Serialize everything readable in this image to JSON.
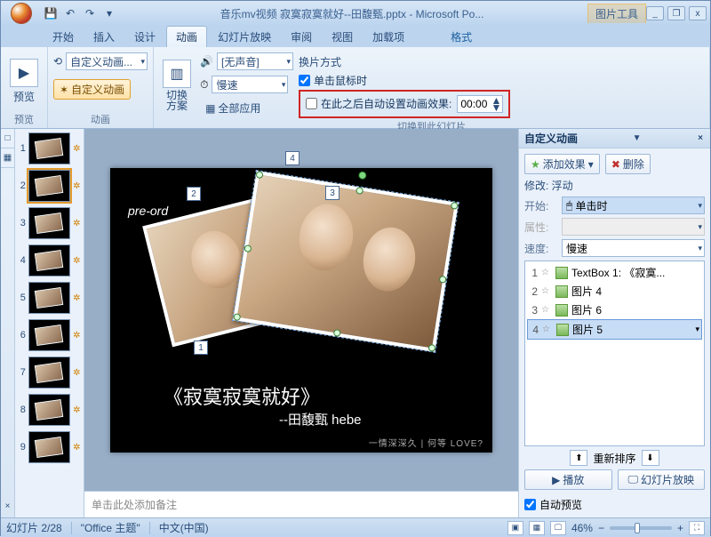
{
  "title": "音乐mv视频 寂寞寂寞就好--田馥甄.pptx - Microsoft Po...",
  "contextual_tab_group": "图片工具",
  "window_buttons": {
    "min": "_",
    "restore": "❐",
    "close": "x"
  },
  "tabs": {
    "items": [
      "开始",
      "插入",
      "设计",
      "动画",
      "幻灯片放映",
      "审阅",
      "视图",
      "加载项"
    ],
    "context": "格式",
    "active_index": 3
  },
  "ribbon": {
    "preview": {
      "label": "预览",
      "btn": "预览"
    },
    "animation": {
      "label": "动画",
      "dd_label": "自定义动画...",
      "btn": "自定义动画"
    },
    "transition": {
      "label": "切换到此幻灯片",
      "scheme_label": "切换\n方案",
      "sound_dd": "[无声音]",
      "speed_dd": "慢速",
      "apply_all": "全部应用",
      "method_title": "换片方式",
      "on_click": "单击鼠标时",
      "auto_after": "在此之后自动设置动画效果:",
      "time": "00:00"
    }
  },
  "nav_tabs": [
    "□",
    "▦"
  ],
  "thumbs": [
    {
      "n": "1",
      "anim": "✲"
    },
    {
      "n": "2",
      "anim": "✲",
      "sel": true
    },
    {
      "n": "3",
      "anim": "✲"
    },
    {
      "n": "4",
      "anim": "✲"
    },
    {
      "n": "5",
      "anim": "✲"
    },
    {
      "n": "6",
      "anim": "✲"
    },
    {
      "n": "7",
      "anim": "✲"
    },
    {
      "n": "8",
      "anim": "✲"
    },
    {
      "n": "9",
      "anim": "✲"
    }
  ],
  "slide": {
    "pre_text": "pre-ord",
    "title": "《寂寞寂寞就好》",
    "subtitle": "--田馥甄 hebe",
    "footer": "一情深深久   | 何等 LOVE?",
    "tags": [
      "1",
      "2",
      "3",
      "4"
    ]
  },
  "notes_placeholder": "单击此处添加备注",
  "pane": {
    "title": "自定义动画",
    "add_effect": "添加效果",
    "remove": "删除",
    "modify_label": "修改: 浮动",
    "start_label": "开始:",
    "start_value": "单击时",
    "prop_label": "属性:",
    "speed_label": "速度:",
    "speed_value": "慢速",
    "effects": [
      {
        "n": "1",
        "m": "☆",
        "name": "TextBox 1: 《寂寞..."
      },
      {
        "n": "2",
        "m": "☆",
        "name": "图片 4"
      },
      {
        "n": "3",
        "m": "☆",
        "name": "图片 6"
      },
      {
        "n": "4",
        "m": "☆",
        "name": "图片 5",
        "sel": true
      }
    ],
    "reorder": "重新排序",
    "play": "播放",
    "slideshow": "幻灯片放映",
    "auto_preview": "自动预览"
  },
  "status": {
    "slide_pos": "幻灯片 2/28",
    "theme": "\"Office 主题\"",
    "lang": "中文(中国)",
    "zoom": "46%"
  }
}
